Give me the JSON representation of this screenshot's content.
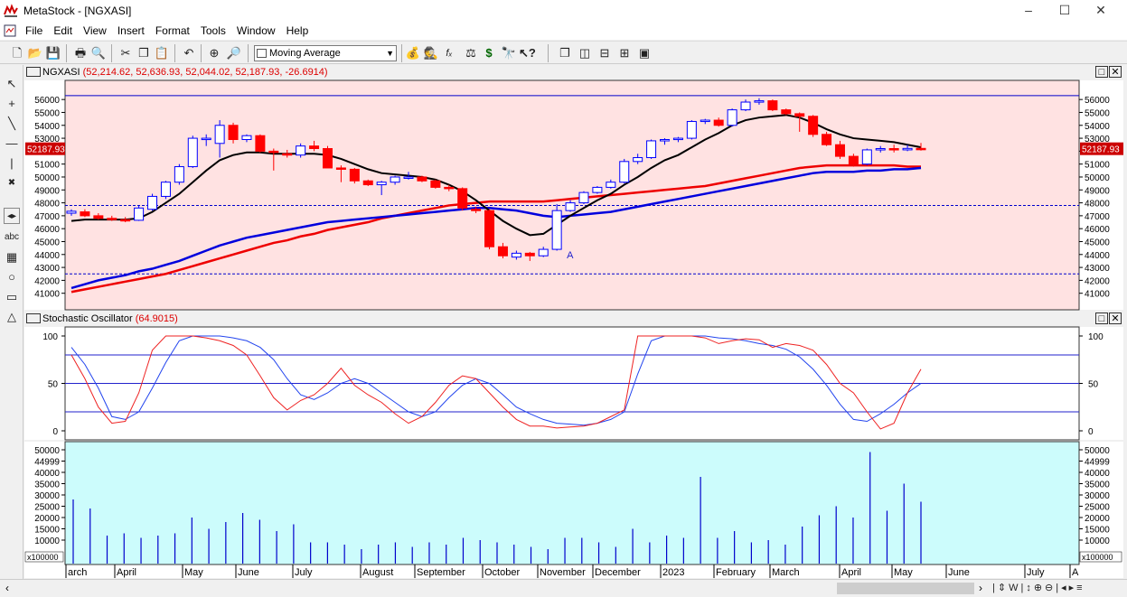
{
  "window": {
    "title": "MetaStock - [NGXASI]"
  },
  "menu": {
    "items": [
      "File",
      "Edit",
      "View",
      "Insert",
      "Format",
      "Tools",
      "Window",
      "Help"
    ]
  },
  "toolbar": {
    "indicator_select": "Moving Average"
  },
  "price_pane": {
    "symbol": "NGXASI",
    "ohlc_text": "(52,214.62, 52,636.93, 52,044.02, 52,187.93, -26.6914)",
    "last_value": "52187.93",
    "marker": "A"
  },
  "stoch_pane": {
    "title": "Stochastic Oscillator",
    "value_text": "(64.9015)"
  },
  "volume_pane": {
    "multiplier": "x100000"
  },
  "colors": {
    "price_bg": "#ffe2e2",
    "volume_bg": "#ccfcfc",
    "up": "#0000ff",
    "down": "#ff0000",
    "ma_short": "#000000",
    "ma_red": "#ee0000",
    "ma_blue": "#0000dd"
  },
  "chart_data": [
    {
      "type": "candlestick",
      "title": "NGXASI",
      "ylim": [
        40000,
        57200
      ],
      "y_ticks": [
        41000,
        42000,
        43000,
        44000,
        45000,
        46000,
        47000,
        48000,
        49000,
        50000,
        51000,
        52000,
        53000,
        54000,
        55000,
        56000
      ],
      "hlines": [
        {
          "value": 56300,
          "style": "solid"
        },
        {
          "value": 47800,
          "style": "dashed"
        },
        {
          "value": 42500,
          "style": "dashed"
        }
      ],
      "months": [
        "arch",
        "April",
        "May",
        "June",
        "July",
        "August",
        "September",
        "October",
        "November",
        "December",
        "2023",
        "February",
        "March",
        "April",
        "May",
        "June",
        "July",
        "A"
      ],
      "candles": [
        {
          "o": 47200,
          "h": 47500,
          "l": 47000,
          "c": 47350
        },
        {
          "o": 47300,
          "h": 47500,
          "l": 46900,
          "c": 47000
        },
        {
          "o": 47000,
          "h": 47200,
          "l": 46700,
          "c": 46800
        },
        {
          "o": 46800,
          "h": 47000,
          "l": 46600,
          "c": 46700
        },
        {
          "o": 46700,
          "h": 46900,
          "l": 46500,
          "c": 46650
        },
        {
          "o": 46650,
          "h": 47800,
          "l": 46600,
          "c": 47600
        },
        {
          "o": 47500,
          "h": 48700,
          "l": 47400,
          "c": 48500
        },
        {
          "o": 48500,
          "h": 49700,
          "l": 48300,
          "c": 49600
        },
        {
          "o": 49600,
          "h": 51000,
          "l": 49400,
          "c": 50800
        },
        {
          "o": 50800,
          "h": 53200,
          "l": 50700,
          "c": 53000
        },
        {
          "o": 53000,
          "h": 53300,
          "l": 52400,
          "c": 53000
        },
        {
          "o": 52600,
          "h": 54400,
          "l": 51500,
          "c": 54000
        },
        {
          "o": 54000,
          "h": 54200,
          "l": 52600,
          "c": 52900
        },
        {
          "o": 52900,
          "h": 53300,
          "l": 52700,
          "c": 53200
        },
        {
          "o": 53200,
          "h": 53300,
          "l": 51900,
          "c": 52000
        },
        {
          "o": 52000,
          "h": 52200,
          "l": 50500,
          "c": 51900
        },
        {
          "o": 51800,
          "h": 52100,
          "l": 51500,
          "c": 51700
        },
        {
          "o": 51700,
          "h": 52600,
          "l": 51500,
          "c": 52400
        },
        {
          "o": 52400,
          "h": 52800,
          "l": 52000,
          "c": 52200
        },
        {
          "o": 52200,
          "h": 52400,
          "l": 50700,
          "c": 50700
        },
        {
          "o": 50700,
          "h": 50900,
          "l": 49600,
          "c": 50600
        },
        {
          "o": 50600,
          "h": 50700,
          "l": 49500,
          "c": 49700
        },
        {
          "o": 49700,
          "h": 49800,
          "l": 49300,
          "c": 49400
        },
        {
          "o": 49400,
          "h": 49700,
          "l": 48600,
          "c": 49600
        },
        {
          "o": 49600,
          "h": 50100,
          "l": 49400,
          "c": 50000
        },
        {
          "o": 50000,
          "h": 50400,
          "l": 49800,
          "c": 50000
        },
        {
          "o": 50000,
          "h": 50100,
          "l": 49600,
          "c": 49700
        },
        {
          "o": 49700,
          "h": 49800,
          "l": 49100,
          "c": 49200
        },
        {
          "o": 49200,
          "h": 49400,
          "l": 48900,
          "c": 49100
        },
        {
          "o": 49100,
          "h": 49200,
          "l": 47400,
          "c": 47600
        },
        {
          "o": 47500,
          "h": 47700,
          "l": 47200,
          "c": 47400
        },
        {
          "o": 47400,
          "h": 47500,
          "l": 44400,
          "c": 44600
        },
        {
          "o": 44600,
          "h": 44900,
          "l": 43700,
          "c": 43900
        },
        {
          "o": 43800,
          "h": 44300,
          "l": 43600,
          "c": 44100
        },
        {
          "o": 44100,
          "h": 44200,
          "l": 43500,
          "c": 43900
        },
        {
          "o": 43900,
          "h": 44600,
          "l": 43800,
          "c": 44400
        },
        {
          "o": 44400,
          "h": 47900,
          "l": 44300,
          "c": 47400
        },
        {
          "o": 47400,
          "h": 48200,
          "l": 47300,
          "c": 48000
        },
        {
          "o": 48000,
          "h": 48900,
          "l": 47900,
          "c": 48800
        },
        {
          "o": 48800,
          "h": 49300,
          "l": 48700,
          "c": 49200
        },
        {
          "o": 49200,
          "h": 49800,
          "l": 49100,
          "c": 49600
        },
        {
          "o": 49600,
          "h": 51400,
          "l": 49500,
          "c": 51200
        },
        {
          "o": 51200,
          "h": 51800,
          "l": 51000,
          "c": 51500
        },
        {
          "o": 51500,
          "h": 52900,
          "l": 51400,
          "c": 52800
        },
        {
          "o": 52800,
          "h": 53000,
          "l": 52500,
          "c": 52900
        },
        {
          "o": 52900,
          "h": 53100,
          "l": 52700,
          "c": 53000
        },
        {
          "o": 53000,
          "h": 54400,
          "l": 52900,
          "c": 54300
        },
        {
          "o": 54300,
          "h": 54500,
          "l": 54100,
          "c": 54400
        },
        {
          "o": 54400,
          "h": 54600,
          "l": 53900,
          "c": 54000
        },
        {
          "o": 54000,
          "h": 55300,
          "l": 53900,
          "c": 55200
        },
        {
          "o": 55200,
          "h": 56000,
          "l": 55100,
          "c": 55800
        },
        {
          "o": 55800,
          "h": 56100,
          "l": 55600,
          "c": 55900
        },
        {
          "o": 55900,
          "h": 56000,
          "l": 55100,
          "c": 55200
        },
        {
          "o": 55200,
          "h": 55300,
          "l": 54800,
          "c": 54900
        },
        {
          "o": 54900,
          "h": 55000,
          "l": 53500,
          "c": 54700
        },
        {
          "o": 54700,
          "h": 54800,
          "l": 53100,
          "c": 53300
        },
        {
          "o": 53300,
          "h": 53500,
          "l": 52400,
          "c": 52500
        },
        {
          "o": 52500,
          "h": 52800,
          "l": 51400,
          "c": 51600
        },
        {
          "o": 51600,
          "h": 51800,
          "l": 50800,
          "c": 51000
        },
        {
          "o": 51000,
          "h": 52200,
          "l": 50900,
          "c": 52100
        },
        {
          "o": 52100,
          "h": 52400,
          "l": 51900,
          "c": 52200
        },
        {
          "o": 52200,
          "h": 52500,
          "l": 51900,
          "c": 52100
        },
        {
          "o": 52100,
          "h": 52500,
          "l": 52000,
          "c": 52214
        },
        {
          "o": 52214,
          "h": 52637,
          "l": 52044,
          "c": 52188
        }
      ],
      "ma_short": [
        46600,
        46700,
        46700,
        46700,
        46700,
        46800,
        47300,
        48000,
        48700,
        49600,
        50500,
        51300,
        51700,
        51900,
        51900,
        51800,
        51800,
        51800,
        51800,
        51700,
        51400,
        51000,
        50600,
        50300,
        50200,
        50100,
        50000,
        49800,
        49400,
        48900,
        48200,
        47400,
        46600,
        46000,
        45500,
        45600,
        46300,
        47000,
        47600,
        48200,
        48700,
        49400,
        50000,
        50700,
        51300,
        51700,
        52300,
        52900,
        53400,
        54000,
        54400,
        54600,
        54700,
        54800,
        54600,
        54200,
        53700,
        53300,
        53000,
        52900,
        52800,
        52700,
        52500,
        52300
      ],
      "ma_red": [
        41100,
        41300,
        41500,
        41700,
        41900,
        42100,
        42300,
        42500,
        42800,
        43100,
        43400,
        43700,
        44000,
        44300,
        44600,
        44900,
        45100,
        45400,
        45600,
        45900,
        46100,
        46300,
        46500,
        46800,
        47000,
        47200,
        47400,
        47600,
        47800,
        47900,
        48000,
        48100,
        48100,
        48100,
        48100,
        48100,
        48200,
        48300,
        48400,
        48500,
        48600,
        48700,
        48800,
        48900,
        49000,
        49100,
        49200,
        49300,
        49500,
        49700,
        49900,
        50100,
        50300,
        50500,
        50700,
        50800,
        50900,
        50900,
        50900,
        50900,
        50900,
        50900,
        50800,
        50800
      ],
      "ma_blue": [
        41400,
        41700,
        42000,
        42200,
        42400,
        42700,
        42900,
        43200,
        43500,
        43900,
        44300,
        44700,
        45000,
        45300,
        45500,
        45700,
        45900,
        46100,
        46300,
        46500,
        46600,
        46700,
        46800,
        46900,
        47000,
        47100,
        47200,
        47300,
        47400,
        47500,
        47600,
        47600,
        47500,
        47400,
        47200,
        47000,
        46900,
        47000,
        47100,
        47200,
        47300,
        47500,
        47700,
        47900,
        48100,
        48300,
        48500,
        48700,
        48900,
        49100,
        49300,
        49500,
        49700,
        49900,
        50100,
        50300,
        50400,
        50400,
        50400,
        50500,
        50500,
        50600,
        50600,
        50700
      ]
    },
    {
      "type": "line",
      "title": "Stochastic Oscillator",
      "ylim": [
        0,
        100
      ],
      "y_ticks": [
        0,
        50,
        100
      ],
      "hlines": [
        80,
        50,
        20
      ],
      "series": [
        {
          "values": [
            88,
            70,
            45,
            15,
            12,
            20,
            45,
            72,
            95,
            100,
            100,
            100,
            98,
            95,
            88,
            75,
            55,
            38,
            33,
            40,
            50,
            55,
            50,
            40,
            30,
            20,
            15,
            20,
            35,
            48,
            55,
            50,
            38,
            25,
            18,
            12,
            8,
            7,
            6,
            8,
            12,
            20,
            60,
            95,
            100,
            100,
            100,
            100,
            98,
            97,
            95,
            92,
            90,
            86,
            78,
            65,
            48,
            28,
            12,
            10,
            18,
            28,
            40,
            50
          ]
        },
        {
          "values": [
            80,
            55,
            25,
            8,
            10,
            40,
            85,
            100,
            100,
            100,
            98,
            95,
            90,
            80,
            58,
            35,
            22,
            32,
            38,
            50,
            66,
            48,
            38,
            30,
            18,
            8,
            15,
            30,
            48,
            58,
            55,
            40,
            25,
            12,
            5,
            5,
            3,
            4,
            5,
            8,
            15,
            22,
            100,
            100,
            100,
            100,
            100,
            98,
            92,
            95,
            97,
            96,
            88,
            92,
            90,
            85,
            70,
            50,
            40,
            20,
            2,
            8,
            40,
            65
          ]
        }
      ]
    },
    {
      "type": "bar",
      "title": "",
      "ylim": [
        0,
        52000
      ],
      "y_ticks": [
        10000,
        15000,
        20000,
        25000,
        30000,
        35000,
        40000,
        44999,
        50000
      ],
      "values": [
        28000,
        0,
        24000,
        0,
        12000,
        0,
        13000,
        0,
        11000,
        0,
        12000,
        0,
        13000,
        0,
        20000,
        0,
        15000,
        0,
        18000,
        0,
        22000,
        0,
        19000,
        0,
        14000,
        0,
        17000,
        0,
        9000,
        0,
        9000,
        0,
        8000,
        0,
        6000,
        0,
        8000,
        0,
        9000,
        0,
        7000,
        0,
        9000,
        0,
        8000,
        0,
        11000,
        0,
        10000,
        0,
        9000,
        0,
        8000,
        0,
        7000,
        0,
        6000,
        0,
        11000,
        0,
        11000,
        0,
        9000,
        0,
        7000,
        0,
        15000,
        0,
        9000,
        0,
        12000,
        0,
        11000,
        0,
        38000,
        0,
        11000,
        0,
        14000,
        0,
        9000,
        0,
        10000,
        0,
        8000,
        0,
        16000,
        0,
        21000,
        0,
        25000,
        0,
        20000,
        0,
        49000,
        0,
        23000,
        0,
        35000,
        0,
        27000
      ]
    }
  ]
}
